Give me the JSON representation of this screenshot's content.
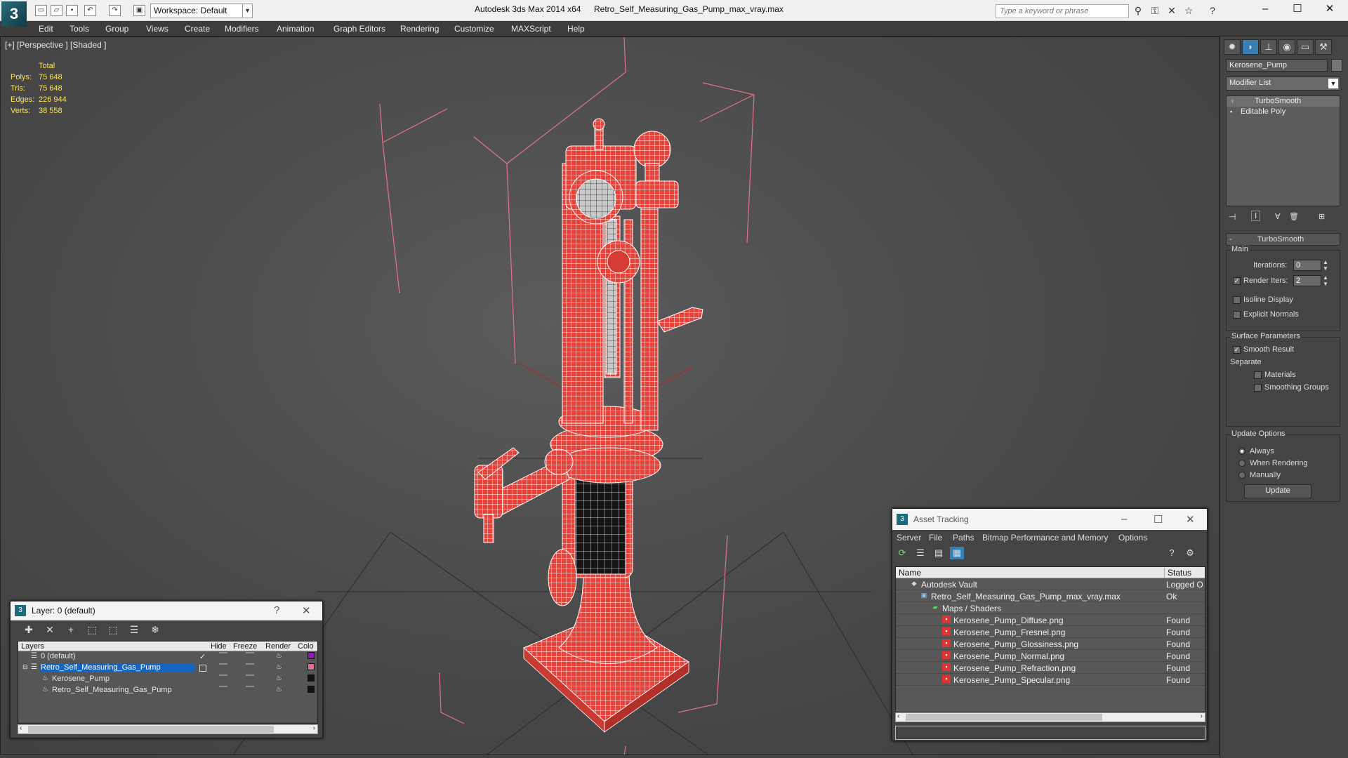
{
  "titlebar": {
    "workspace": "Workspace: Default",
    "app_title": "Autodesk 3ds Max  2014 x64",
    "file_title": "Retro_Self_Measuring_Gas_Pump_max_vray.max",
    "search_placeholder": "Type a keyword or phrase"
  },
  "menu": [
    "Edit",
    "Tools",
    "Group",
    "Views",
    "Create",
    "Modifiers",
    "Animation",
    "Graph Editors",
    "Rendering",
    "Customize",
    "MAXScript",
    "Help"
  ],
  "viewport": {
    "label": "[+] [Perspective ] [Shaded ]",
    "stats_header": "Total",
    "stats": [
      {
        "label": "Polys:",
        "value": "75 648"
      },
      {
        "label": "Tris:",
        "value": "75 648"
      },
      {
        "label": "Edges:",
        "value": "226 944"
      },
      {
        "label": "Verts:",
        "value": "38 558"
      }
    ]
  },
  "command_panel": {
    "object_name": "Kerosene_Pump",
    "modifier_list": "Modifier List",
    "stack": [
      "TurboSmooth",
      "Editable Poly"
    ],
    "rollout_title": "TurboSmooth",
    "main_label": "Main",
    "iterations_label": "Iterations:",
    "iterations_value": "0",
    "render_iters_label": "Render Iters:",
    "render_iters_value": "2",
    "render_iters_checked": true,
    "isoline": "Isoline Display",
    "explicit_normals": "Explicit Normals",
    "surface_params": "Surface Parameters",
    "smooth_result": "Smooth Result",
    "separate": "Separate",
    "materials": "Materials",
    "smoothing_groups": "Smoothing Groups",
    "update_options": "Update Options",
    "always": "Always",
    "when_rendering": "When Rendering",
    "manually": "Manually",
    "update_button": "Update"
  },
  "layer_dialog": {
    "title": "Layer: 0 (default)",
    "help": "?",
    "columns": [
      "Layers",
      "Hide",
      "Freeze",
      "Render",
      "Colo"
    ],
    "rows": [
      {
        "name": "0 (default)",
        "indent": 0,
        "color": "#8b1fa8",
        "selected": false
      },
      {
        "name": "Retro_Self_Measuring_Gas_Pump",
        "indent": 0,
        "color": "#d9728c",
        "selected": true
      },
      {
        "name": "Kerosene_Pump",
        "indent": 1,
        "color": "#111111",
        "selected": false
      },
      {
        "name": "Retro_Self_Measuring_Gas_Pump",
        "indent": 1,
        "color": "#111111",
        "selected": false
      }
    ]
  },
  "asset_dialog": {
    "title": "Asset Tracking",
    "menu": [
      "Server",
      "File",
      "Paths",
      "Bitmap Performance and Memory",
      "Options"
    ],
    "columns": [
      "Name",
      "Status"
    ],
    "rows": [
      {
        "name": "Autodesk Vault",
        "status": "Logged O",
        "indent": 1,
        "icon": "vault-icon"
      },
      {
        "name": "Retro_Self_Measuring_Gas_Pump_max_vray.max",
        "status": "Ok",
        "indent": 2,
        "icon": "max-file-icon"
      },
      {
        "name": "Maps / Shaders",
        "status": "",
        "indent": 3,
        "icon": "folder-icon"
      },
      {
        "name": "Kerosene_Pump_Diffuse.png",
        "status": "Found",
        "indent": 4,
        "icon": "png-icon"
      },
      {
        "name": "Kerosene_Pump_Fresnel.png",
        "status": "Found",
        "indent": 4,
        "icon": "png-icon"
      },
      {
        "name": "Kerosene_Pump_Glossiness.png",
        "status": "Found",
        "indent": 4,
        "icon": "png-icon"
      },
      {
        "name": "Kerosene_Pump_Normal.png",
        "status": "Found",
        "indent": 4,
        "icon": "png-icon"
      },
      {
        "name": "Kerosene_Pump_Refraction.png",
        "status": "Found",
        "indent": 4,
        "icon": "png-icon"
      },
      {
        "name": "Kerosene_Pump_Specular.png",
        "status": "Found",
        "indent": 4,
        "icon": "png-icon"
      }
    ]
  },
  "colors": {
    "wire": "#ff3b30",
    "bbox": "#e4738a",
    "selection": "#1565c0",
    "stats": "#ffe45a"
  }
}
